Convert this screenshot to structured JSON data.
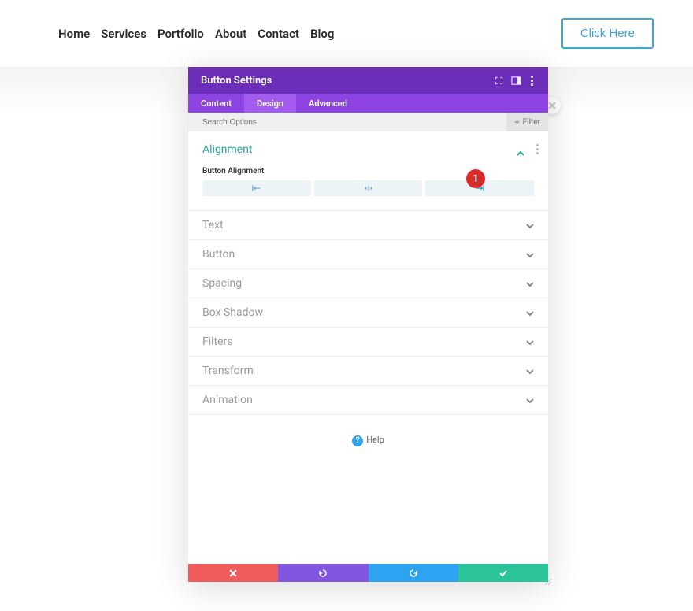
{
  "nav": {
    "items": [
      "Home",
      "Services",
      "Portfolio",
      "About",
      "Contact",
      "Blog"
    ],
    "cta": "Click Here"
  },
  "modal": {
    "title": "Button Settings",
    "tabs": [
      "Content",
      "Design",
      "Advanced"
    ],
    "active_tab": 1,
    "search_placeholder": "Search Options",
    "filter_label": "Filter",
    "alignment": {
      "title": "Alignment",
      "field_label": "Button Alignment",
      "selected": "right"
    },
    "closed_sections": [
      "Text",
      "Button",
      "Spacing",
      "Box Shadow",
      "Filters",
      "Transform",
      "Animation"
    ],
    "help": "Help",
    "badge": "1"
  }
}
